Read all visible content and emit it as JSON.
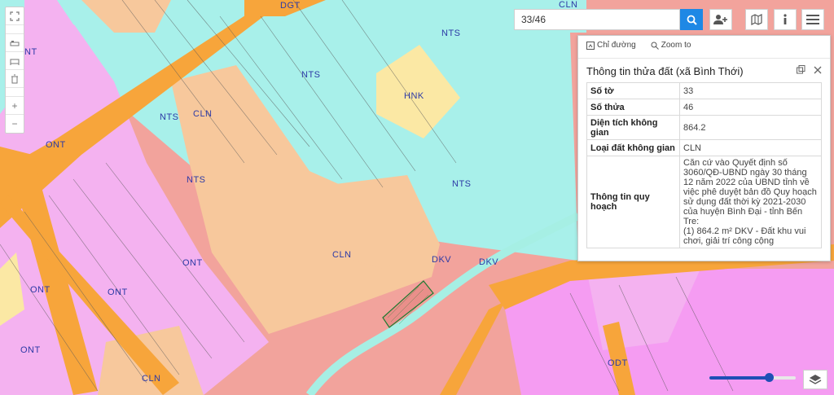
{
  "colors": {
    "nts": "#a8f0ea",
    "cln": "#f7c89c",
    "ont": "#f4b2f0",
    "road": "#f7a53b",
    "dkv": "#f2a39c",
    "hnk": "#fbe8a4",
    "odt": "#f59cf2",
    "water": "#a6efe4",
    "accent": "#1e88e5"
  },
  "map_labels": [
    "DGT",
    "NTS",
    "NT",
    "NTS",
    "HNK",
    "CLN",
    "NTS",
    "NTS",
    "ONT",
    "NTS",
    "CLN",
    "ONT",
    "ONT",
    "ONT",
    "DKV",
    "DKV",
    "ONT",
    "CLN",
    "CLN",
    "ODT"
  ],
  "toolbar": {
    "tools": [
      "fullscreen-icon",
      "bed-icon",
      "bed-icon",
      "trash-icon"
    ],
    "zoom_in": "+",
    "zoom_out": "−"
  },
  "search": {
    "value": "33/46",
    "search_icon": "search-icon",
    "buttons": [
      "add-user-icon",
      "map-icon",
      "info-icon",
      "menu-icon"
    ]
  },
  "panel": {
    "directions_label": "Chỉ đường",
    "zoom_to_label": "Zoom to",
    "title": "Thông tin thửa đất (xã Bình Thới)",
    "rows": [
      {
        "key": "Số tờ",
        "value": "33"
      },
      {
        "key": "Số thửa",
        "value": "46"
      },
      {
        "key": "Diện tích không gian",
        "value": "864.2"
      },
      {
        "key": "Loại đất không gian",
        "value": "CLN"
      },
      {
        "key": "Thông tin quy hoạch",
        "value": "Căn cứ vào Quyết định số 3060/QĐ-UBND ngày 30 tháng 12 năm 2022 của UBND tỉnh về việc phê duyệt bản đồ Quy hoạch sử dụng đất thời kỳ 2021-2030 của huyện Bình Đại - tỉnh Bến Tre:"
      },
      {
        "key": "",
        "value": "(1) 864.2 m² DKV - Đất khu vui chơi, giải trí công cộng"
      }
    ]
  },
  "zoom_level": 0.69
}
